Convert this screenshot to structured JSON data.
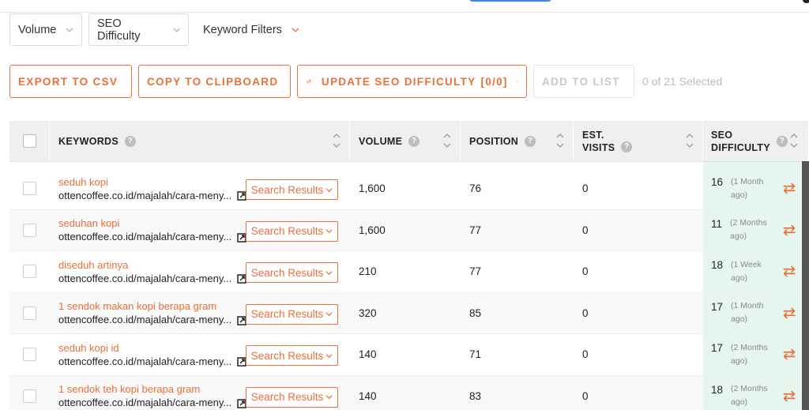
{
  "filters": {
    "volume": "Volume",
    "seo_difficulty": "SEO Difficulty",
    "keyword_filters": "Keyword Filters"
  },
  "actions": {
    "export": "EXPORT TO CSV",
    "copy": "COPY TO CLIPBOARD",
    "update": "UPDATE SEO DIFFICULTY",
    "update_count": "[0/0]",
    "add_to_list": "ADD TO LIST",
    "selected": "0 of 21 Selected"
  },
  "table": {
    "headers": {
      "keywords": "KEYWORDS",
      "volume": "VOLUME",
      "position": "POSITION",
      "est_visits_line1": "EST.",
      "est_visits_line2": "VISITS",
      "seo_line1": "SEO",
      "seo_line2": "DIFFICULTY"
    },
    "search_results_label": "Search Results",
    "rows": [
      {
        "keyword": "seduh kopi",
        "url": "ottencoffee.co.id/majalah/cara-meny...",
        "volume": "1,600",
        "position": "76",
        "visits": "0",
        "seo": "16",
        "when": "(1 Month ago)"
      },
      {
        "keyword": "seduhan kopi",
        "url": "ottencoffee.co.id/majalah/cara-meny...",
        "volume": "1,600",
        "position": "77",
        "visits": "0",
        "seo": "11",
        "when": "(2 Months ago)"
      },
      {
        "keyword": "diseduh artinya",
        "url": "ottencoffee.co.id/majalah/cara-meny...",
        "volume": "210",
        "position": "77",
        "visits": "0",
        "seo": "18",
        "when": "(1 Week ago)"
      },
      {
        "keyword": "1 sendok makan kopi berapa gram",
        "url": "ottencoffee.co.id/majalah/cara-meny...",
        "volume": "320",
        "position": "85",
        "visits": "0",
        "seo": "17",
        "when": "(1 Month ago)"
      },
      {
        "keyword": "seduh kopi id",
        "url": "ottencoffee.co.id/majalah/cara-meny...",
        "volume": "140",
        "position": "71",
        "visits": "0",
        "seo": "17",
        "when": "(2 Months ago)"
      },
      {
        "keyword": "1 sendok teh kopi berapa gram",
        "url": "ottencoffee.co.id/majalah/cara-meny...",
        "volume": "140",
        "position": "83",
        "visits": "0",
        "seo": "18",
        "when": "(2 Months ago)"
      }
    ]
  },
  "colors": {
    "accent": "#e8703a",
    "seo_bg": "#e6f6ee",
    "header_bg": "#efefef"
  }
}
